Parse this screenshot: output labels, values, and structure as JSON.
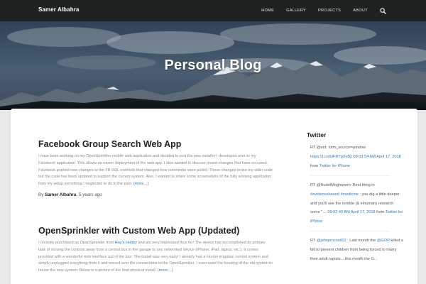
{
  "nav": {
    "brand": "Samer Albahra",
    "items": [
      "HOME",
      "GALLERY",
      "PROJECTS",
      "ABOUT"
    ],
    "search_icon": "search-icon"
  },
  "hero": {
    "title": "Personal Blog"
  },
  "posts": [
    {
      "title": "Facebook Group Search Web App",
      "excerpt": "I have been working on my OpenSprinkler mobile web application and decided to port the new installer I developed over to my Facebook application. This allows an easier deployment of the web app. I also wanted to discuss recent changes that have occurred. Facebook pushed new changes to the FB SQL methods that changed how comments were polled. These changes broke my older code but the code has been updated to support the current system. Also, I wanted to share some screenshots of the fully working application from my setup something I neglected to do in the past.",
      "more": "(more…)",
      "meta_prefix": "By ",
      "author": "Samer Albahra",
      "meta_suffix": ", 5 years ago"
    },
    {
      "title": "OpenSprinkler with Custom Web App (Updated)",
      "excerpt_before_link": "I recently purchased an OpenSprinkler from ",
      "excerpt_link": "Ray's Hobby",
      "excerpt_after_link": " and am very impressed thus far! The device has accomplished its primary task of moving the controls away from a central box in the garage to any networked device (iPhone, iPad, laptop, etc.). It comes provided with a wonderful web interface out of the box. The install was very easy! I already had a Hunter irrigation control system and simply unplugged everything from it and moved over the connections to the OpenSprinkler. I even used the housing of the old system to house the new system. Below is a picture of the final physical install.",
      "more": "(more…)"
    }
  ],
  "twitter": {
    "title": "Twitter",
    "tweets": [
      {
        "p1": "RT @ent: !utm_source=window",
        "link": "https://t.co/bIFRTgXvBx",
        "time": "09:03:54 AM April 17, 2018",
        "from_prefix": " from ",
        "source": "Twitter for iPhone"
      },
      {
        "p1": "RT @NurielMoghavem: Best thing in ",
        "tag1": "#evidencebased",
        "tag2": "#medicine",
        "p2": " : you dig a little deeper and you'll see the terrible (& inhuman) research some \"…",
        "time": "09:02:40 AM April 17, 2018",
        "from_prefix": " from ",
        "source": "Twitter for iPhone"
      },
      {
        "p1": "RT ",
        "handle": "@johnpmcneil02",
        "p2": " : Last month the ",
        "handle2": "@GOP",
        "p3": " killed a bill to prevent children from being forced to marry their adult rapists... this month the G..."
      }
    ]
  }
}
